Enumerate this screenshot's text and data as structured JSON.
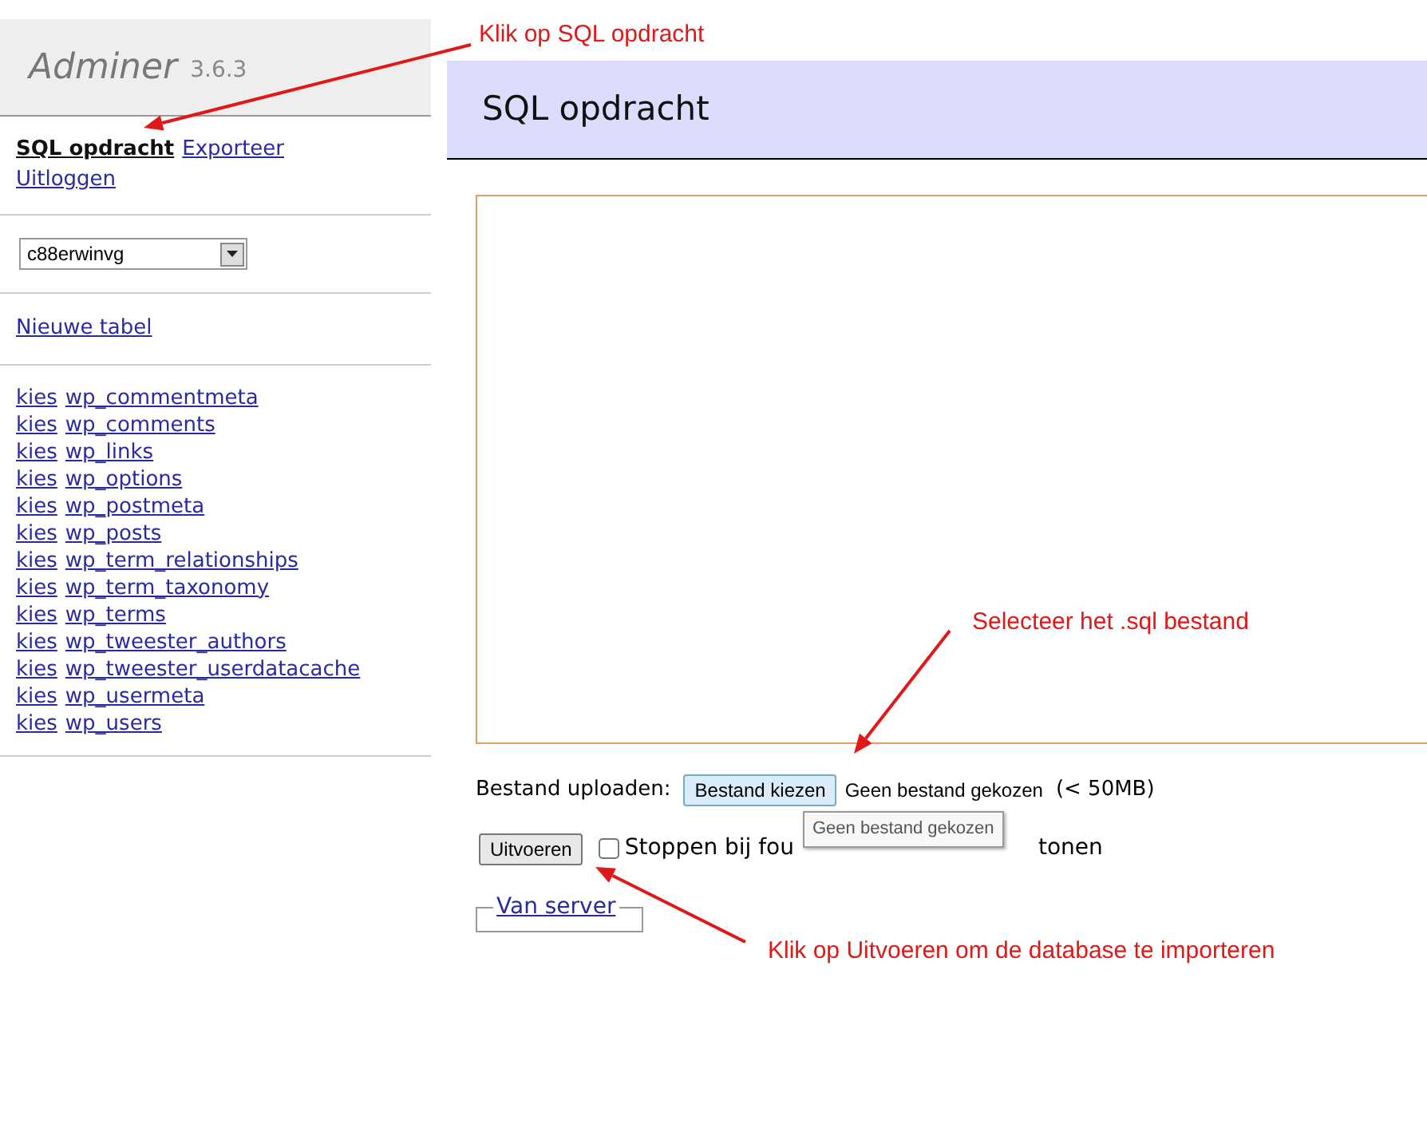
{
  "sidebar": {
    "logo": "Adminer",
    "version": "3.6.3",
    "links": [
      {
        "label": "SQL opdracht",
        "selected": true
      },
      {
        "label": "Exporteer",
        "selected": false
      },
      {
        "label": "Uitloggen",
        "selected": false
      }
    ],
    "database_select": {
      "value": "c88erwinvg"
    },
    "new_table_link": "Nieuwe tabel",
    "tables": [
      {
        "select_link": "kies",
        "name": "wp_commentmeta"
      },
      {
        "select_link": "kies",
        "name": "wp_comments"
      },
      {
        "select_link": "kies",
        "name": "wp_links"
      },
      {
        "select_link": "kies",
        "name": "wp_options"
      },
      {
        "select_link": "kies",
        "name": "wp_postmeta"
      },
      {
        "select_link": "kies",
        "name": "wp_posts"
      },
      {
        "select_link": "kies",
        "name": "wp_term_relationships"
      },
      {
        "select_link": "kies",
        "name": "wp_term_taxonomy"
      },
      {
        "select_link": "kies",
        "name": "wp_terms"
      },
      {
        "select_link": "kies",
        "name": "wp_tweester_authors"
      },
      {
        "select_link": "kies",
        "name": "wp_tweester_userdatacache"
      },
      {
        "select_link": "kies",
        "name": "wp_usermeta"
      },
      {
        "select_link": "kies",
        "name": "wp_users"
      }
    ]
  },
  "main": {
    "title": "SQL opdracht",
    "file_upload": {
      "label": "Bestand uploaden:",
      "button": "Bestand kiezen",
      "status": "Geen bestand gekozen",
      "limit": "(< 50MB)"
    },
    "execute_button": "Uitvoeren",
    "stop_on_error": {
      "checked": false,
      "label_start": "Stoppen bij fou",
      "label_end": "tonen"
    },
    "tooltip": "Geen bestand gekozen",
    "server_fieldset": {
      "legend": "Van server"
    }
  },
  "annotations": [
    {
      "text": "Klik op SQL opdracht"
    },
    {
      "text": "Selecteer het .sql bestand"
    },
    {
      "text": "Klik op Uitvoeren om de database te importeren"
    }
  ]
}
